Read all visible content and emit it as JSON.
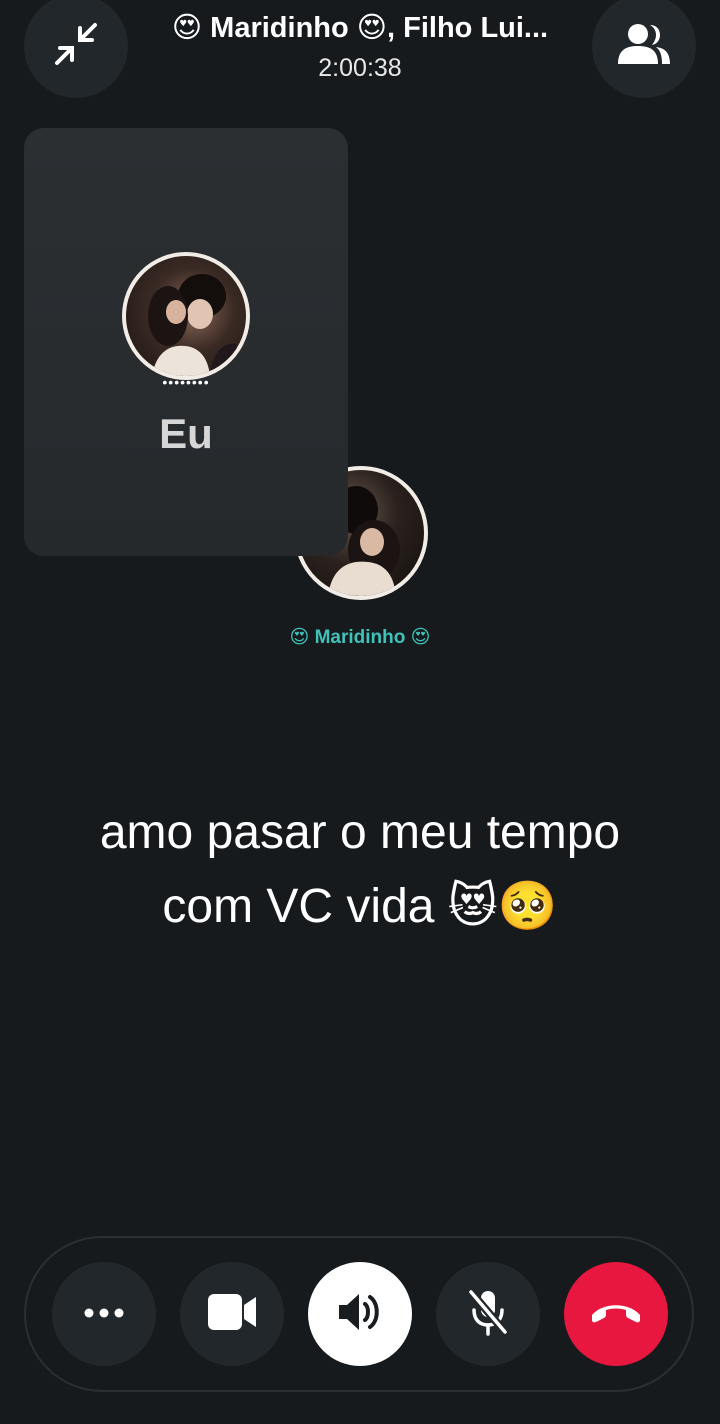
{
  "header": {
    "title": "😍 Maridinho 😍, Filho Lui...",
    "timer": "2:00:38"
  },
  "self_tile": {
    "avatar_dots": "••••••••",
    "name": "Eu"
  },
  "remote": {
    "name": "😍 Maridinho 😍"
  },
  "caption": {
    "line1": "amo pasar o meu tempo",
    "line2": "com VC vida 😻🥺"
  },
  "controls": {
    "buttons": [
      "more",
      "video",
      "speaker",
      "mute",
      "end-call"
    ]
  },
  "icons": {
    "minimize": "minimize-arrows-icon",
    "participants": "participants-icon",
    "more": "more-dots-icon",
    "video": "video-camera-icon",
    "speaker": "speaker-icon",
    "mic": "mic-off-icon",
    "end": "phone-hangup-icon"
  },
  "colors": {
    "background": "#161a1d",
    "button": "#22272b",
    "end_call": "#e8173f",
    "remote_name": "#3fc3b9"
  }
}
